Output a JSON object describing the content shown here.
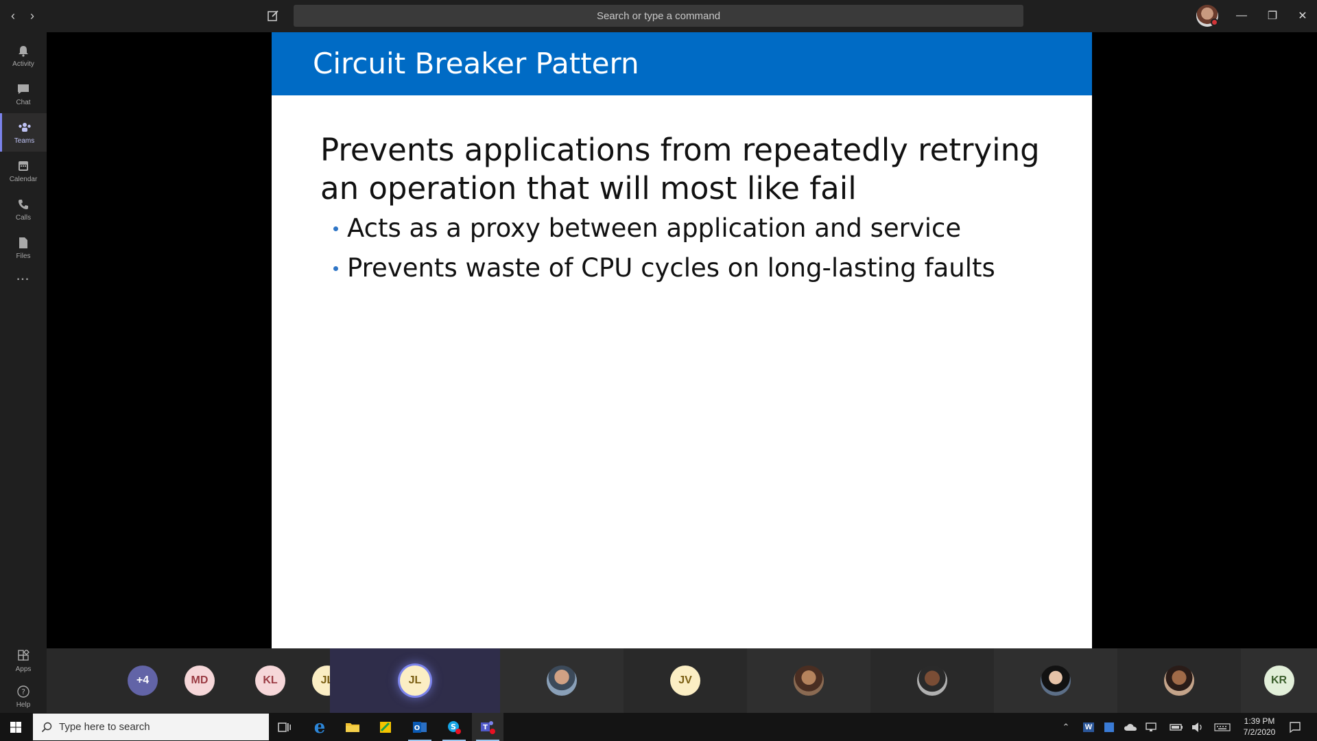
{
  "titlebar": {
    "search_placeholder": "Search or type a command",
    "back_icon": "chevron-left-icon",
    "forward_icon": "chevron-right-icon",
    "compose_icon": "compose-icon",
    "profile_status_color": "#d13438"
  },
  "rail": {
    "items": [
      {
        "label": "Activity",
        "icon": "bell-icon"
      },
      {
        "label": "Chat",
        "icon": "chat-icon"
      },
      {
        "label": "Teams",
        "icon": "teams-icon",
        "active": true
      },
      {
        "label": "Calendar",
        "icon": "calendar-icon"
      },
      {
        "label": "Calls",
        "icon": "phone-icon"
      },
      {
        "label": "Files",
        "icon": "file-icon"
      }
    ],
    "more": "...",
    "bottom": [
      {
        "label": "Apps",
        "icon": "apps-icon"
      },
      {
        "label": "Help",
        "icon": "help-icon"
      }
    ]
  },
  "slide": {
    "title": "Circuit Breaker Pattern",
    "lead": "Prevents applications from repeatedly retrying an operation that will most like fail",
    "bullets": [
      "Acts as a proxy between application and service",
      "Prevents waste of CPU cycles on long-lasting faults"
    ],
    "header_color": "#006bc5"
  },
  "participants": [
    {
      "initials": "+4",
      "bg": "#6264a7",
      "fg": "#ffffff"
    },
    {
      "initials": "MD",
      "bg": "#f6d7d9",
      "fg": "#9a3b43"
    },
    {
      "initials": "KL",
      "bg": "#f6d7d9",
      "fg": "#9a3b43"
    },
    {
      "initials": "JL",
      "bg": "#fbeec4",
      "fg": "#7a5e12"
    },
    {
      "initials": "JL",
      "bg": "#fbeec4",
      "fg": "#7a5e12",
      "active": true
    },
    {
      "photo": true
    },
    {
      "initials": "JV",
      "bg": "#fbeec4",
      "fg": "#7a5e12"
    },
    {
      "photo": true
    },
    {
      "photo": true
    },
    {
      "photo": true
    },
    {
      "photo": true
    },
    {
      "initials": "KR",
      "bg": "#e2efd9",
      "fg": "#3a5e2b"
    }
  ],
  "taskbar": {
    "search_placeholder": "Type here to search",
    "time": "1:39 PM",
    "date": "7/2/2020"
  }
}
